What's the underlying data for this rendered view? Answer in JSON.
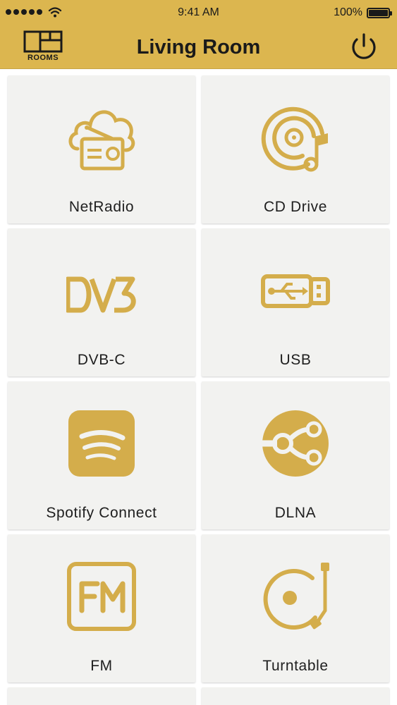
{
  "status_bar": {
    "time": "9:41 AM",
    "battery": "100%",
    "signal_icon": "signal-dots-icon",
    "wifi_icon": "wifi-icon",
    "battery_icon": "battery-icon"
  },
  "header": {
    "title": "Living Room",
    "rooms_label": "ROOMS",
    "rooms_icon": "rooms-icon",
    "power_icon": "power-icon"
  },
  "colors": {
    "accent": "#dcb64f",
    "icon": "#d4ad4b",
    "tile": "#f2f2f0",
    "text": "#1e1e1e"
  },
  "sources": [
    {
      "label": "NetRadio",
      "icon": "cloud-radio-icon"
    },
    {
      "label": "CD Drive",
      "icon": "cd-music-icon"
    },
    {
      "label": "DVB-C",
      "icon": "dvb-icon"
    },
    {
      "label": "USB",
      "icon": "usb-icon"
    },
    {
      "label": "Spotify Connect",
      "icon": "spotify-icon"
    },
    {
      "label": "DLNA",
      "icon": "dlna-icon"
    },
    {
      "label": "FM",
      "icon": "fm-icon"
    },
    {
      "label": "Turntable",
      "icon": "turntable-icon"
    }
  ]
}
